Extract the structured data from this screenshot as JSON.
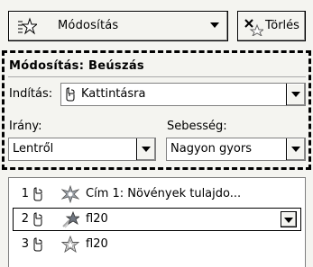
{
  "toolbar": {
    "modify_label": "Módosítás",
    "modify_icon": "star-effect-icon",
    "delete_label": "Törlés",
    "delete_icon": "delete-effect-icon"
  },
  "section": {
    "title": "Módosítás: Beúszás",
    "start_label": "Indítás:",
    "start_value": "Kattintásra",
    "direction_label": "Irány:",
    "direction_value": "Lentről",
    "speed_label": "Sebesség:",
    "speed_value": "Nagyon gyors"
  },
  "list": {
    "items": [
      {
        "number": "1",
        "trigger_icon": "mouse-icon",
        "effect_icon": "sparkle-effect-icon",
        "text": "Cím 1: Növények tulajdo...",
        "selected": false
      },
      {
        "number": "2",
        "trigger_icon": "mouse-icon",
        "effect_icon": "fly-in-effect-icon",
        "text": "fl20",
        "selected": true
      },
      {
        "number": "3",
        "trigger_icon": "mouse-icon",
        "effect_icon": "star-outline-effect-icon",
        "text": "fl20",
        "selected": false
      }
    ]
  }
}
